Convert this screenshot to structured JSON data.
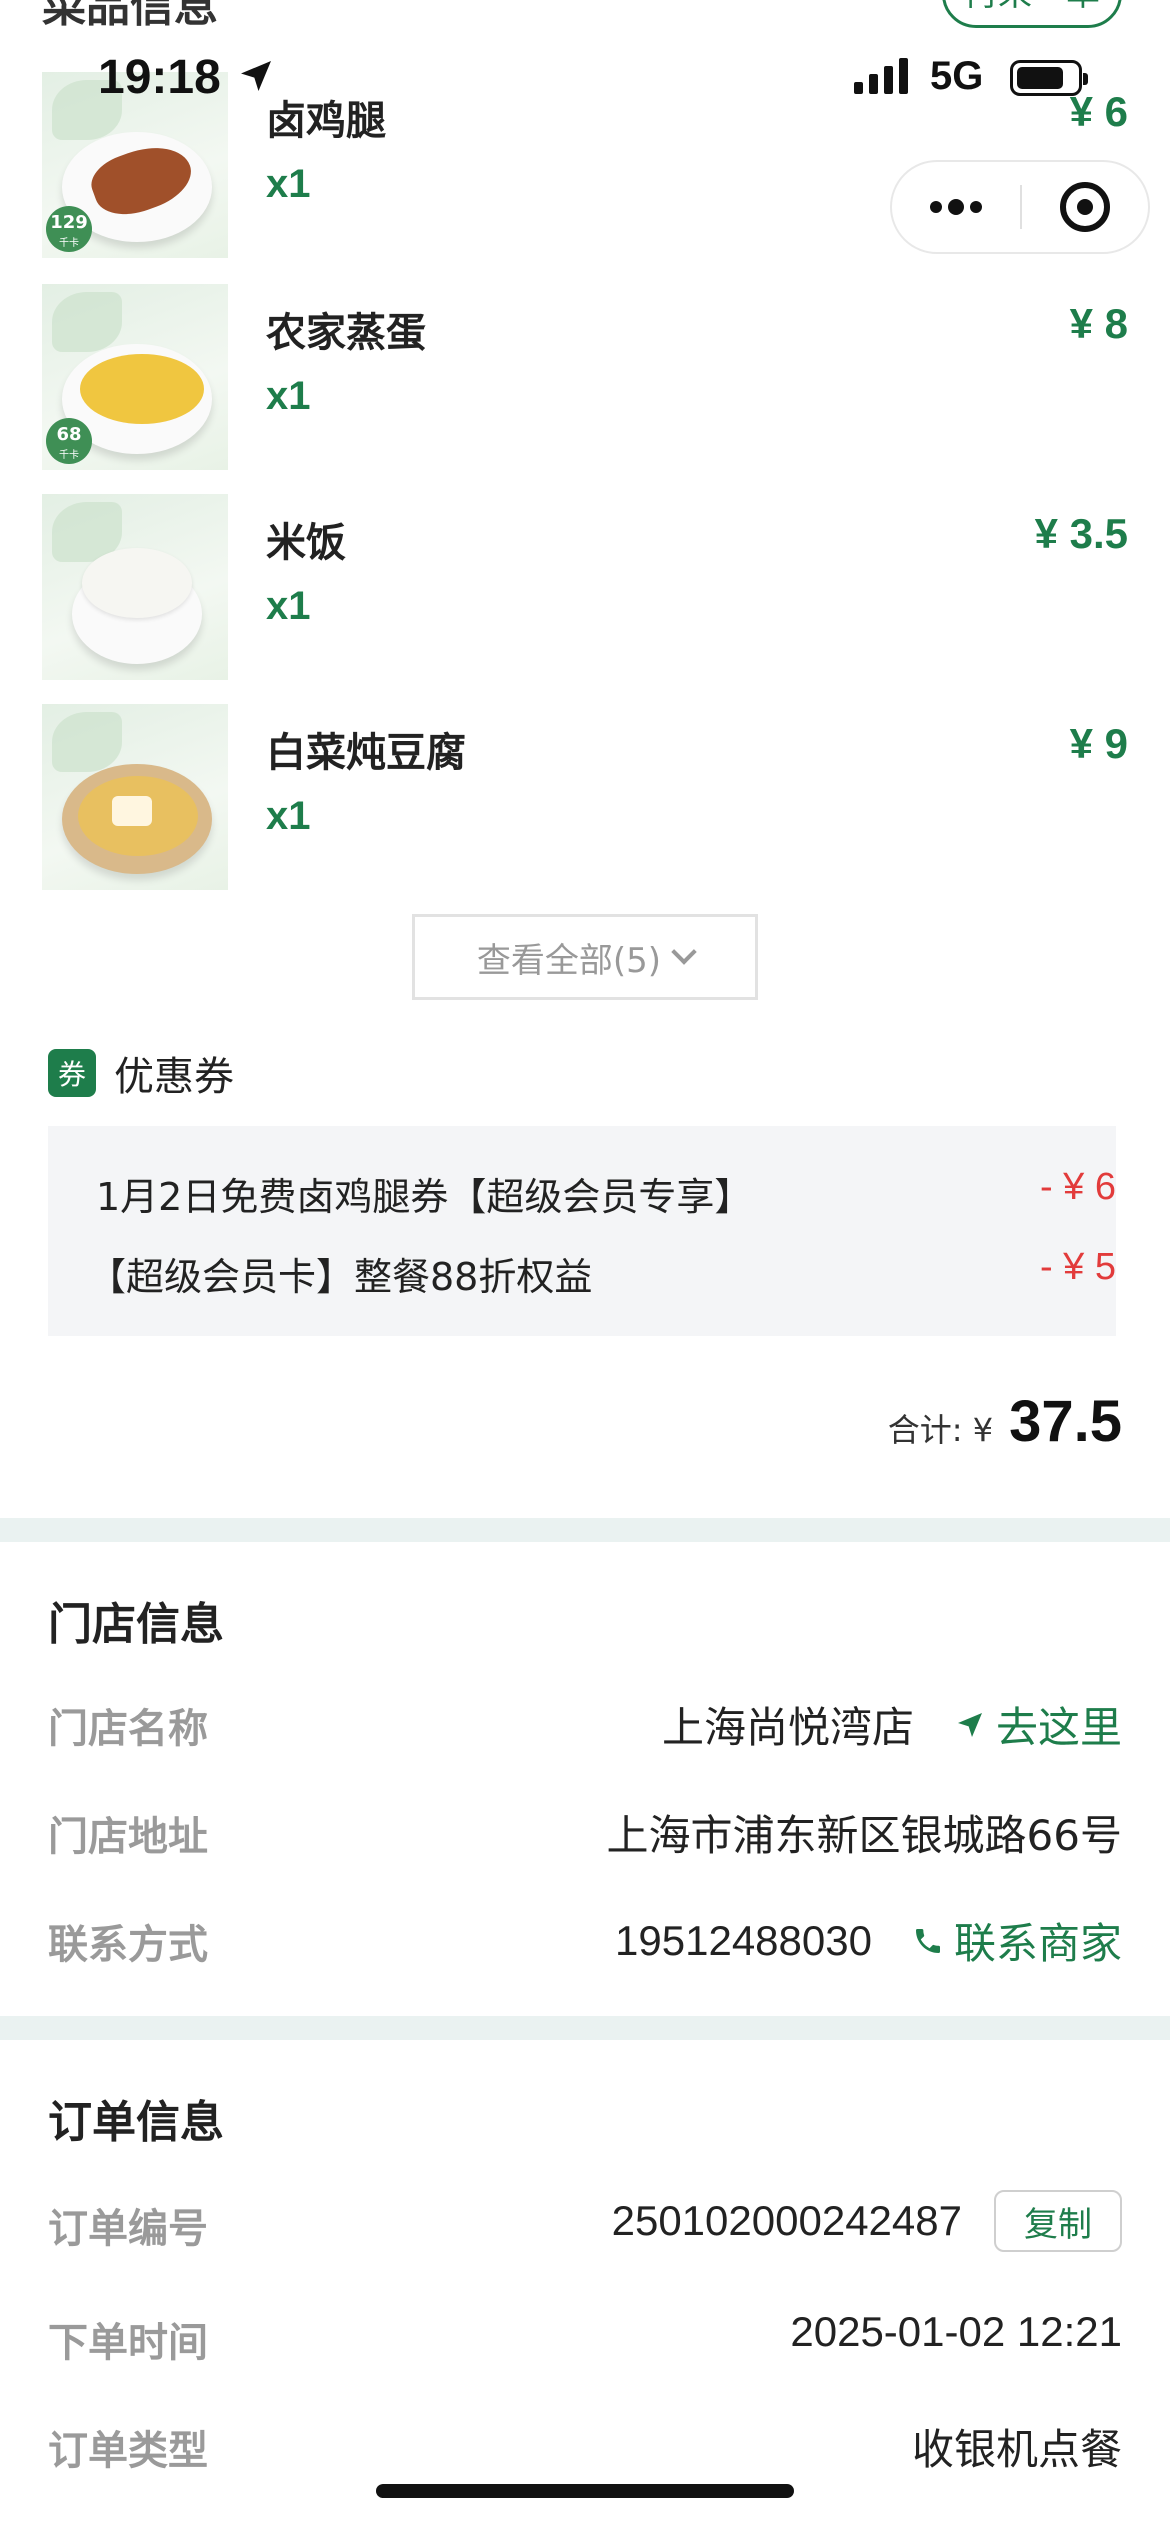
{
  "status": {
    "time": "19:18",
    "network": "5G"
  },
  "top": {
    "section_title": "菜品信息",
    "pill_label": "再来一单"
  },
  "dishes": [
    {
      "name": "卤鸡腿",
      "qty": "x1",
      "price": "¥ 6",
      "calories": "129",
      "cal_unit": "千卡"
    },
    {
      "name": "农家蒸蛋",
      "qty": "x1",
      "price": "¥ 8",
      "calories": "68",
      "cal_unit": "千卡"
    },
    {
      "name": "米饭",
      "qty": "x1",
      "price": "¥ 3.5"
    },
    {
      "name": "白菜炖豆腐",
      "qty": "x1",
      "price": "¥ 9"
    }
  ],
  "view_all": "查看全部(5)",
  "coupon": {
    "badge": "券",
    "title": "优惠券",
    "items": [
      {
        "name": "1月2日免费卤鸡腿券【超级会员专享】",
        "amount": "- ¥ 6"
      },
      {
        "name": "【超级会员卡】整餐88折权益",
        "amount": "- ¥ 5"
      }
    ]
  },
  "total": {
    "label": "合计: ¥",
    "value": "37.5"
  },
  "store": {
    "title": "门店信息",
    "name_label": "门店名称",
    "name": "上海尚悦湾店",
    "go_label": "去这里",
    "address_label": "门店地址",
    "address": "上海市浦东新区银城路66号",
    "contact_label": "联系方式",
    "phone": "19512488030",
    "contact_link": "联系商家"
  },
  "order": {
    "title": "订单信息",
    "number_label": "订单编号",
    "number": "250102000242487",
    "copy_label": "复制",
    "time_label": "下单时间",
    "time": "2025-01-02 12:21",
    "type_label": "订单类型",
    "type": "收银机点餐"
  },
  "colors": {
    "brand_green": "#1e7d4b",
    "discount_red": "#e23b3b",
    "divider": "#eaf2f1"
  }
}
